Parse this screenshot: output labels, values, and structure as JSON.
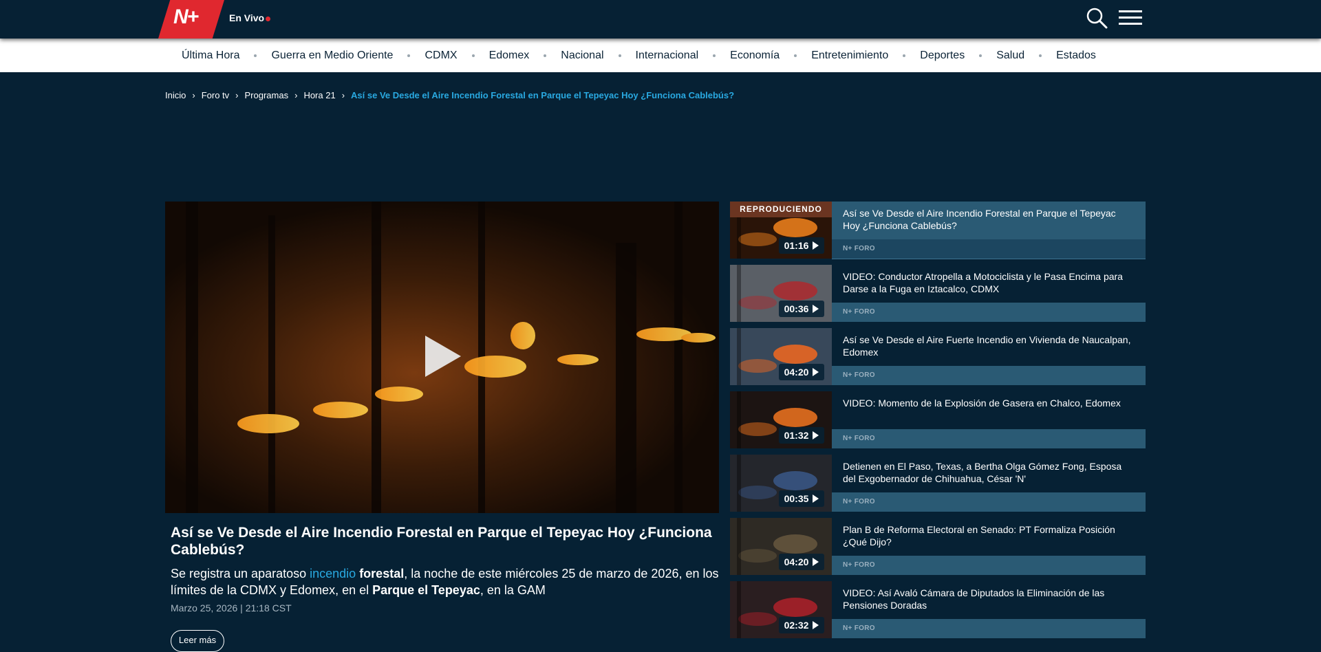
{
  "header": {
    "logo_text": "N+",
    "live_label": "En Vivo"
  },
  "nav": {
    "items": [
      "Última Hora",
      "Guerra en Medio Oriente",
      "CDMX",
      "Edomex",
      "Nacional",
      "Internacional",
      "Economía",
      "Entretenimiento",
      "Deportes",
      "Salud",
      "Estados"
    ]
  },
  "breadcrumb": {
    "items": [
      "Inicio",
      "Foro tv",
      "Programas",
      "Hora 21"
    ],
    "current": "Así se Ve Desde el Aire Incendio Forestal en Parque el Tepeyac Hoy ¿Funciona Cablebús?"
  },
  "article": {
    "title": "Así se Ve Desde el Aire Incendio Forestal en Parque el Tepeyac Hoy ¿Funciona Cablebús?",
    "lead_part1": "Se registra un aparatoso ",
    "lead_link": "incendio",
    "lead_bold1": " forestal",
    "lead_part2": ", la noche de este miércoles 25 de marzo de 2026, en los límites de la CDMX y Edomex, en el ",
    "lead_bold2": "Parque el Tepeyac",
    "lead_part3": ", en la GAM",
    "date": "Marzo 25, 2026 | 21:18 CST",
    "read_button": "Leer más"
  },
  "playlist": {
    "now_playing_label": "REPRODUCIENDO",
    "items": [
      {
        "title": "Así se Ve Desde el Aire Incendio Forestal en Parque el Tepeyac Hoy ¿Funciona Cablebús?",
        "duration": "01:16",
        "source": "N+ FORO"
      },
      {
        "title": "VIDEO: Conductor Atropella a Motociclista y le Pasa Encima para Darse a la Fuga en Iztacalco, CDMX",
        "duration": "00:36",
        "source": "N+ FORO"
      },
      {
        "title": "Así se Ve Desde el Aire Fuerte Incendio en Vivienda de Naucalpan, Edomex",
        "duration": "04:20",
        "source": "N+ FORO"
      },
      {
        "title": "VIDEO: Momento de la Explosión de Gasera en Chalco, Edomex",
        "duration": "01:32",
        "source": "N+ FORO"
      },
      {
        "title": "Detienen en El Paso, Texas, a Bertha Olga Gómez Fong, Esposa del Exgobernador de Chihuahua, César 'N'",
        "duration": "00:35",
        "source": "N+ FORO"
      },
      {
        "title": "Plan B de Reforma Electoral en Senado: PT Formaliza Posición ¿Qué Dijo?",
        "duration": "04:20",
        "source": "N+ FORO"
      },
      {
        "title": "VIDEO: Así Avaló Cámara de Diputados la Eliminación de las Pensiones Doradas",
        "duration": "02:32",
        "source": "N+ FORO"
      }
    ]
  },
  "colors": {
    "background": "#062134",
    "brand_red": "#e0282f",
    "accent_blue": "#29a9e1",
    "playlist_bar": "#2a5a74"
  }
}
